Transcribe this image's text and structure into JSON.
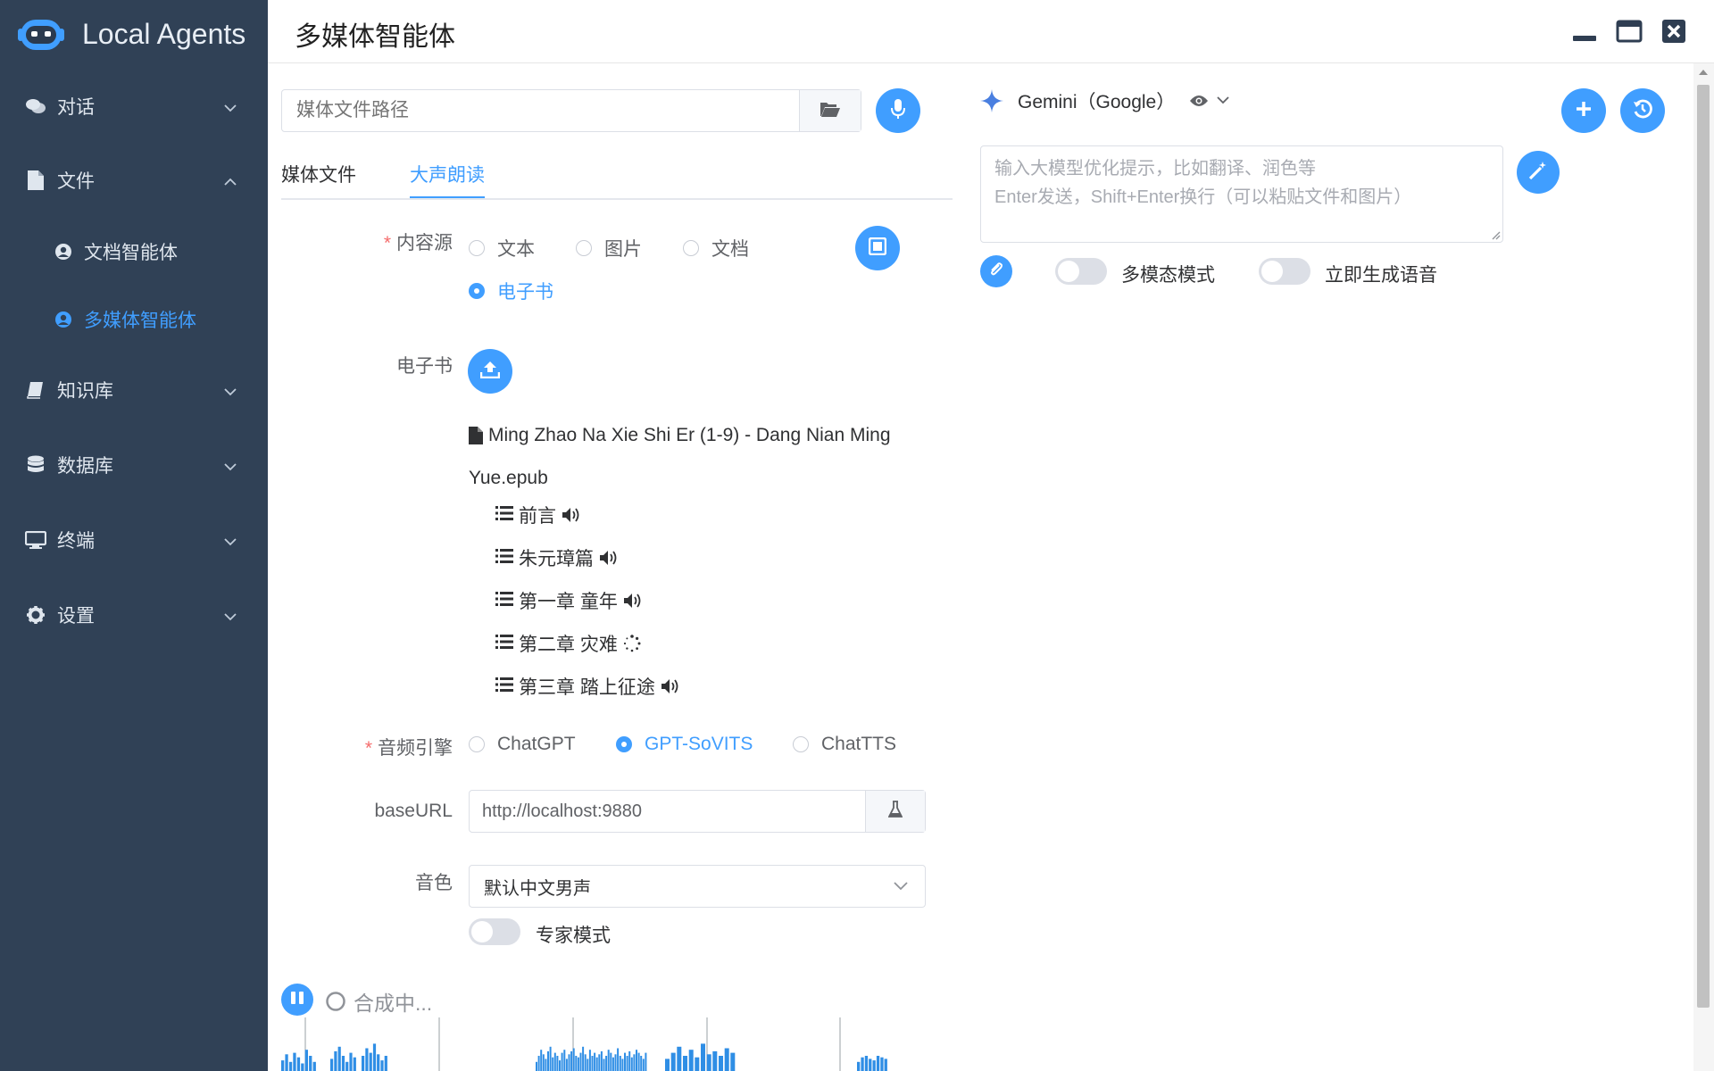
{
  "app": {
    "brand": "Local Agents",
    "page_title": "多媒体智能体"
  },
  "sidebar": {
    "items": [
      {
        "label": "对话",
        "icon": "chat-icon",
        "expanded": false
      },
      {
        "label": "文件",
        "icon": "file-icon",
        "expanded": true
      },
      {
        "label": "知识库",
        "icon": "book-icon",
        "expanded": false
      },
      {
        "label": "数据库",
        "icon": "database-icon",
        "expanded": false
      },
      {
        "label": "终端",
        "icon": "monitor-icon",
        "expanded": false
      },
      {
        "label": "设置",
        "icon": "gear-icon",
        "expanded": false
      }
    ],
    "sub_items": [
      {
        "label": "文档智能体",
        "active": false
      },
      {
        "label": "多媒体智能体",
        "active": true
      }
    ]
  },
  "left_panel": {
    "path_input": {
      "placeholder": "媒体文件路径",
      "value": ""
    },
    "tabs": [
      {
        "label": "媒体文件",
        "active": false
      },
      {
        "label": "大声朗读",
        "active": true
      }
    ],
    "content_source": {
      "label": "内容源",
      "options": [
        "文本",
        "图片",
        "文档",
        "电子书"
      ],
      "selected": "电子书"
    },
    "ebook": {
      "label": "电子书",
      "filename_line1": "Ming Zhao Na Xie Shi Er (1-9) - Dang Nian Ming",
      "filename_line2": "Yue.epub",
      "chapters": [
        {
          "title": "前言",
          "status": "ready"
        },
        {
          "title": "朱元璋篇",
          "status": "ready"
        },
        {
          "title": "第一章 童年",
          "status": "ready"
        },
        {
          "title": "第二章 灾难",
          "status": "loading"
        },
        {
          "title": "第三章 踏上征途",
          "status": "ready"
        }
      ]
    },
    "audio_engine": {
      "label": "音频引擎",
      "options": [
        "ChatGPT",
        "GPT-SoVITS",
        "ChatTTS"
      ],
      "selected": "GPT-SoVITS"
    },
    "base_url": {
      "label": "baseURL",
      "value": "http://localhost:9880"
    },
    "voice": {
      "label": "音色",
      "value": "默认中文男声"
    },
    "expert_mode": {
      "label": "专家模式",
      "on": false
    },
    "player": {
      "status": "合成中..."
    }
  },
  "right_panel": {
    "model": {
      "name": "Gemini（Google）"
    },
    "prompt": {
      "placeholder_line1": "输入大模型优化提示，比如翻译、润色等",
      "placeholder_line2": "Enter发送，Shift+Enter换行（可以粘贴文件和图片）"
    },
    "switches": [
      {
        "label": "多模态模式",
        "on": false
      },
      {
        "label": "立即生成语音",
        "on": false
      }
    ]
  },
  "waveform": {
    "color": "#2f8ee5",
    "segments": [
      {
        "values": [
          0.35,
          0.55,
          0.3,
          0.6,
          0.45,
          0.25,
          0.7,
          0.5,
          0.3
        ]
      },
      {
        "values": [
          0.4,
          0.65,
          0.8,
          0.5,
          0.3,
          0.6,
          0.45
        ]
      },
      {
        "values": [
          0.5,
          0.75,
          0.6,
          0.9,
          0.55,
          0.35,
          0.5
        ]
      },
      {
        "values": [
          0.3,
          0.5,
          0.7,
          0.55,
          0.4,
          0.65,
          0.8,
          0.45,
          0.6,
          0.5,
          0.35,
          0.6,
          0.7,
          0.4,
          0.55,
          0.65,
          0.75,
          0.5,
          0.45,
          0.6,
          0.8,
          0.55,
          0.4,
          0.7,
          0.5,
          0.6,
          0.45,
          0.55,
          0.65,
          0.4,
          0.5,
          0.7,
          0.6,
          0.45,
          0.55,
          0.75,
          0.5,
          0.4,
          0.6,
          0.5,
          0.65,
          0.45,
          0.55,
          0.7,
          0.6,
          0.5,
          0.4,
          0.6
        ]
      },
      {
        "values": [
          0.4,
          0.6,
          0.8,
          0.5,
          0.7,
          0.45,
          0.9,
          0.55,
          0.65,
          0.5,
          0.75,
          0.6
        ]
      },
      {
        "values": [
          0.3,
          0.45,
          0.5,
          0.4,
          0.35,
          0.5,
          0.45,
          0.4
        ]
      }
    ]
  },
  "colors": {
    "accent": "#409eff",
    "sidebar": "#304156"
  }
}
